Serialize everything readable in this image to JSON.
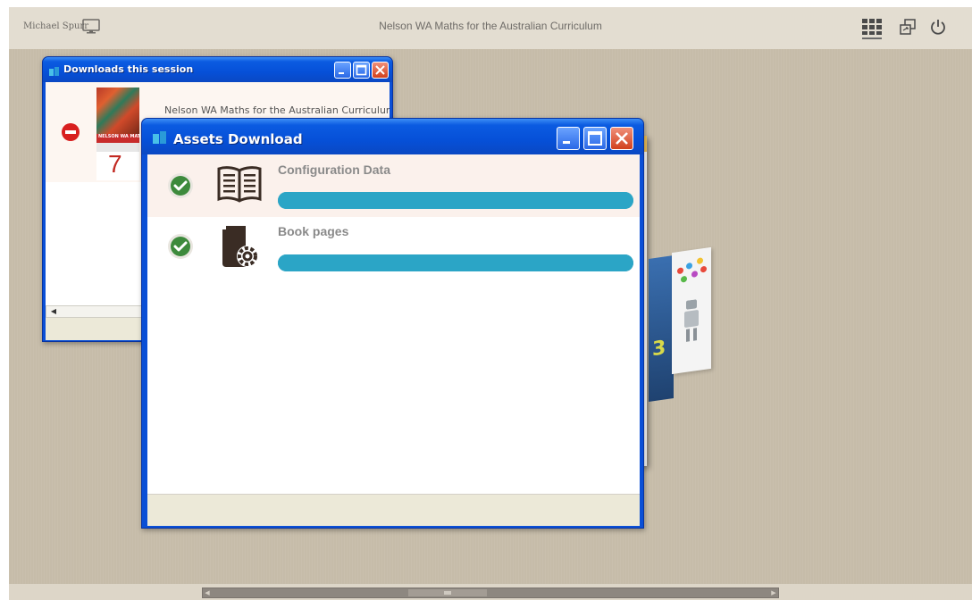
{
  "app": {
    "title": "Nelson WA Maths for the Australian Curriculum",
    "user_name": "Michael Spurr"
  },
  "icons": {
    "monitor": "monitor-icon",
    "grid": "grid-view-icon",
    "switch": "switch-window-icon",
    "power": "power-icon"
  },
  "downloads_window": {
    "title": "Downloads this session",
    "items": [
      {
        "name": "Nelson WA Maths for the Australian Curriculum",
        "cover_brand": "NELSON WA MATHS",
        "cover_number": "7"
      }
    ]
  },
  "assets_window": {
    "title": "Assets Download",
    "items": [
      {
        "label": "Configuration Data",
        "progress": 1.0,
        "status": "complete"
      },
      {
        "label": "Book pages",
        "progress": 1.0,
        "status": "complete"
      }
    ]
  },
  "background_book": {
    "digit": "3"
  },
  "colors": {
    "xp_title_blue": "#0650d8",
    "progress_teal": "#2ba5c6",
    "check_green": "#3d8a3c",
    "remove_red": "#d81f1f",
    "desktop_tan": "#c6bca9"
  }
}
